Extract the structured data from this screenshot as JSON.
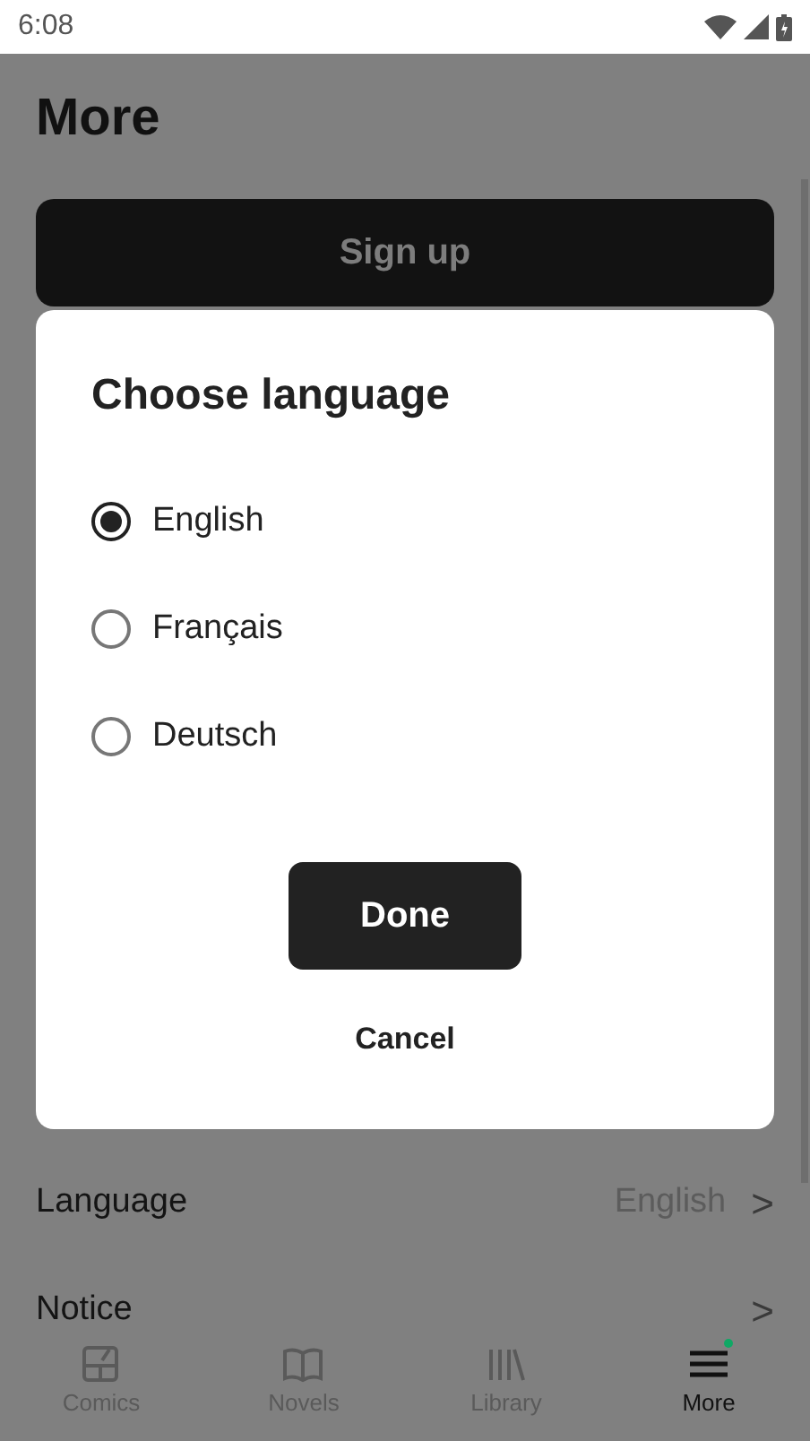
{
  "status_bar": {
    "time": "6:08"
  },
  "page": {
    "title": "More",
    "signup_button": "Sign up"
  },
  "settings": [
    {
      "label": "Language",
      "value": "English",
      "chevron": ">"
    },
    {
      "label": "Notice",
      "chevron": ">"
    }
  ],
  "dialog": {
    "title": "Choose language",
    "options": [
      {
        "label": "English",
        "selected": true
      },
      {
        "label": "Français",
        "selected": false
      },
      {
        "label": "Deutsch",
        "selected": false
      }
    ],
    "done_button": "Done",
    "cancel_button": "Cancel"
  },
  "bottom_nav": [
    {
      "label": "Comics",
      "selected": false,
      "badge": false
    },
    {
      "label": "Novels",
      "selected": false,
      "badge": false
    },
    {
      "label": "Library",
      "selected": false,
      "badge": false
    },
    {
      "label": "More",
      "selected": true,
      "badge": true
    }
  ]
}
